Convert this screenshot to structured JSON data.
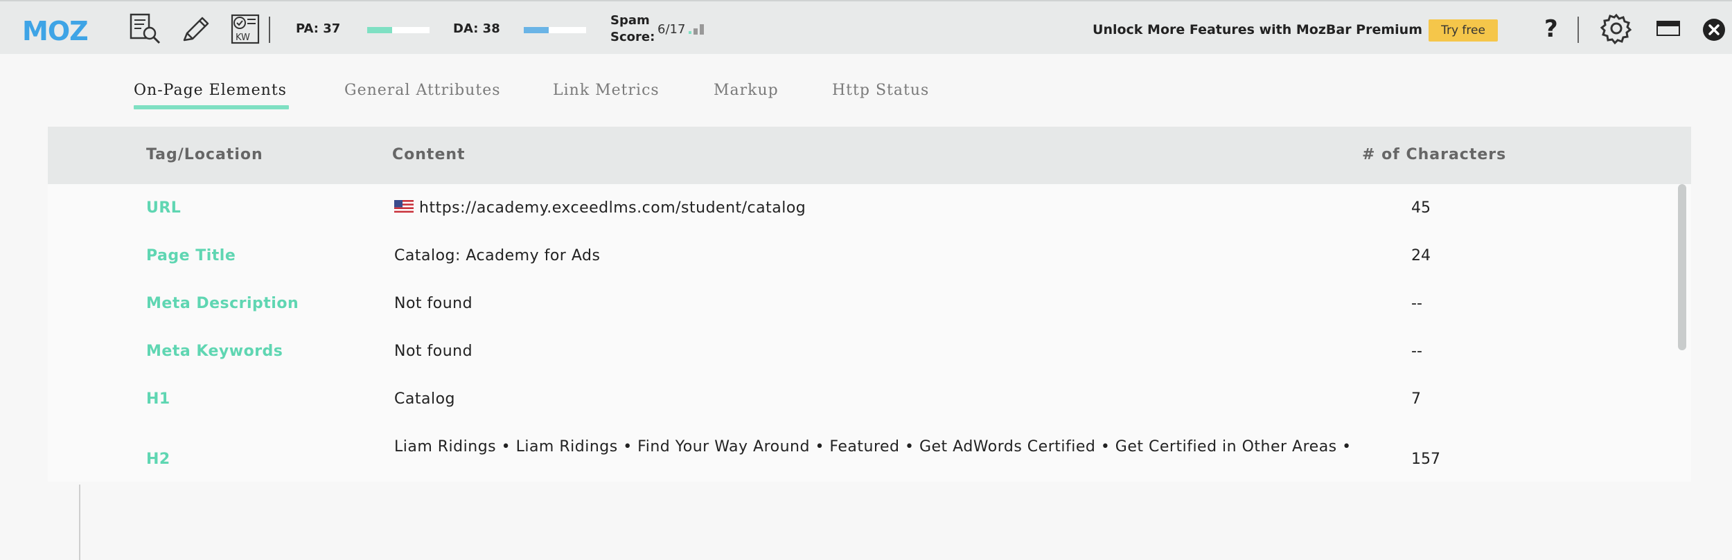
{
  "toolbar": {
    "logo_text": "MOZ",
    "icons": [
      "page-analysis-icon",
      "highlighter-pencil-icon",
      "keyword-check-icon",
      "help-icon",
      "settings-gear-icon",
      "layout-toggle-icon",
      "close-icon"
    ],
    "pa_label": "PA: 37",
    "pa_value": 37,
    "pa_fill_fraction": 0.4,
    "da_label": "DA: 38",
    "da_value": 38,
    "da_fill_fraction": 0.4,
    "spam_label": "Spam Score:",
    "spam_value": "6/17",
    "unlock_text": "Unlock More Features with MozBar Premium",
    "try_free_label": "Try free",
    "help_label": "?",
    "colors": {
      "pa_bar": "#7fe0c3",
      "da_bar": "#6ab4e6",
      "logo": "#3ea4e6",
      "try_free_bg": "#f5c64a"
    }
  },
  "tabs": [
    {
      "label": "On-Page Elements",
      "active": true
    },
    {
      "label": "General Attributes",
      "active": false
    },
    {
      "label": "Link Metrics",
      "active": false
    },
    {
      "label": "Markup",
      "active": false
    },
    {
      "label": "Http Status",
      "active": false
    }
  ],
  "table": {
    "headers": {
      "tag": "Tag/Location",
      "content": "Content",
      "count": "# of Characters"
    },
    "rows": [
      {
        "tag": "URL",
        "content": "https://academy.exceedlms.com/student/catalog",
        "count": "45",
        "flag": "us-flag-icon"
      },
      {
        "tag": "Page Title",
        "content": "Catalog: Academy for Ads",
        "count": "24"
      },
      {
        "tag": "Meta Description",
        "content": "Not found",
        "count": "--"
      },
      {
        "tag": "Meta Keywords",
        "content": "Not found",
        "count": "--"
      },
      {
        "tag": "H1",
        "content": "Catalog",
        "count": "7"
      },
      {
        "tag": "H2",
        "content": "Liam Ridings • Liam Ridings • Find Your Way Around • Featured • Get AdWords Certified • Get Certified in Other Areas •",
        "count": "157"
      }
    ]
  }
}
